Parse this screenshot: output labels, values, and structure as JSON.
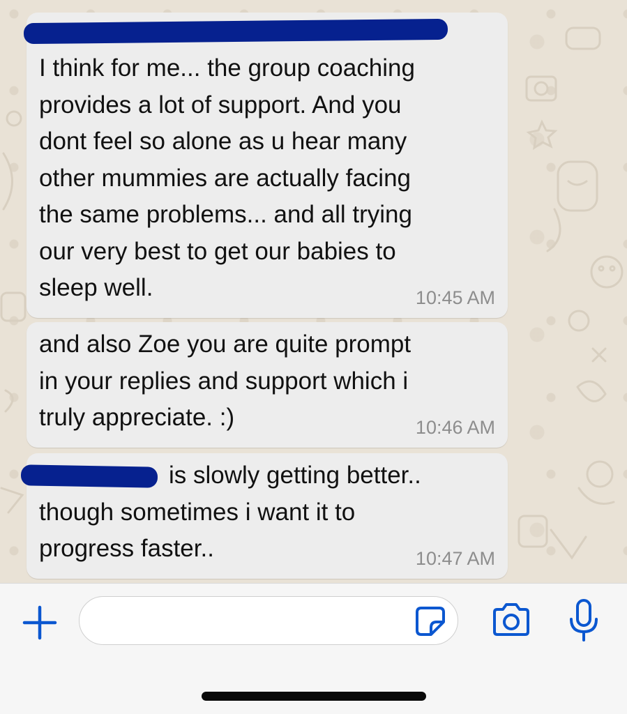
{
  "messages": [
    {
      "text": "I think for me... the group coaching\nprovides a lot of support. And you\ndont feel so alone as u hear many\nother mummies are actually facing\nthe same problems... and all trying\nour very best to get our babies to\nsleep well.",
      "time": "10:45 AM",
      "redacted": true
    },
    {
      "text": "and also Zoe you are quite prompt\nin your replies and support which i\ntruly appreciate. :)",
      "time": "10:46 AM"
    },
    {
      "text": "is slowly getting better..\nthough sometimes i want it to\nprogress faster..",
      "time": "10:47 AM",
      "redacted": true
    }
  ],
  "composer": {
    "placeholder": "",
    "icons": [
      "plus-icon",
      "sticker-icon",
      "camera-icon",
      "microphone-icon"
    ],
    "accent_color": "#0b57d0"
  },
  "colors": {
    "bubble": "#ededed",
    "redaction": "#06218f",
    "wallpaper": "#e9e2d6"
  }
}
